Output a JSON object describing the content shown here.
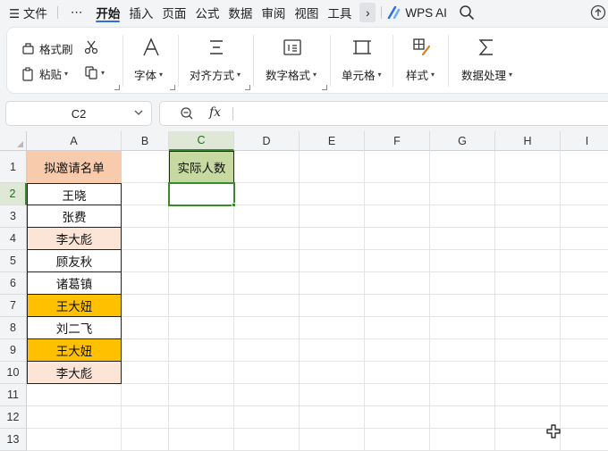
{
  "menu": {
    "items": [
      {
        "label": "☰ 文件",
        "name": "menu-file"
      },
      {
        "label": "⋯",
        "name": "menu-more-dots"
      },
      {
        "label": "开始",
        "name": "menu-home",
        "active": true
      },
      {
        "label": "插入",
        "name": "menu-insert"
      },
      {
        "label": "页面",
        "name": "menu-page"
      },
      {
        "label": "公式",
        "name": "menu-formula"
      },
      {
        "label": "数据",
        "name": "menu-data"
      },
      {
        "label": "审阅",
        "name": "menu-review"
      },
      {
        "label": "视图",
        "name": "menu-view"
      },
      {
        "label": "工具",
        "name": "menu-tools"
      }
    ],
    "more_glyph": "›",
    "ai_label": "WPS AI"
  },
  "ribbon": {
    "format_painter": "格式刷",
    "paste": "粘贴",
    "font": "字体",
    "align": "对齐方式",
    "number_format": "数字格式",
    "cell": "单元格",
    "style": "样式",
    "data_process": "数据处理"
  },
  "formula_bar": {
    "name_box": "C2",
    "fx": "fx",
    "value": ""
  },
  "sheet": {
    "columns": [
      "A",
      "B",
      "C",
      "D",
      "E",
      "F",
      "G",
      "H",
      "I"
    ],
    "rows": [
      "1",
      "2",
      "3",
      "4",
      "5",
      "6",
      "7",
      "8",
      "9",
      "10",
      "11",
      "12",
      "13"
    ],
    "selected_cell": "C2",
    "header_A1": "拟邀请名单",
    "header_C1": "实际人数",
    "names": [
      "王晓",
      "张费",
      "李大彪",
      "顾友秋",
      "诸葛镇",
      "王大妞",
      "刘二飞",
      "王大妞",
      "李大彪"
    ],
    "name_fills": [
      "#ffffff",
      "#ffffff",
      "#fce4d6",
      "#ffffff",
      "#ffffff",
      "#ffc000",
      "#ffffff",
      "#ffc000",
      "#fce4d6"
    ]
  },
  "colors": {
    "header_A1_fill": "#f8cbad",
    "header_C1_fill": "#c6d9a0",
    "selection": "#3a8a2a",
    "accent": "#2f6fdf"
  }
}
